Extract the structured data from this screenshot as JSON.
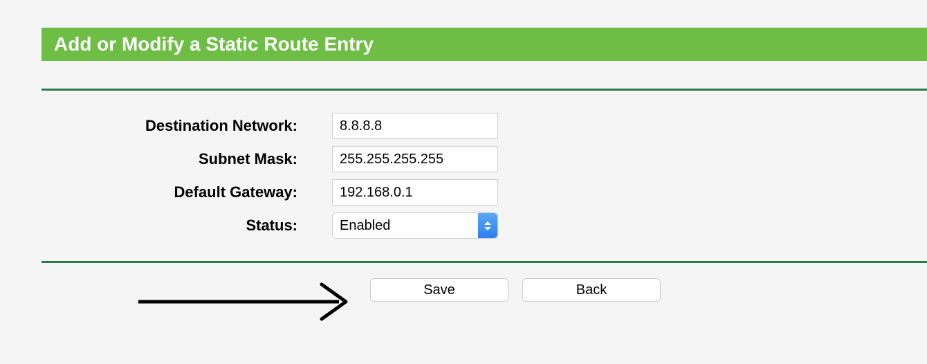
{
  "header": {
    "title": "Add or Modify a Static Route Entry"
  },
  "form": {
    "destination_network": {
      "label": "Destination Network:",
      "value": "8.8.8.8"
    },
    "subnet_mask": {
      "label": "Subnet Mask:",
      "value": "255.255.255.255"
    },
    "default_gateway": {
      "label": "Default Gateway:",
      "value": "192.168.0.1"
    },
    "status": {
      "label": "Status:",
      "value": "Enabled"
    }
  },
  "buttons": {
    "save": "Save",
    "back": "Back"
  }
}
